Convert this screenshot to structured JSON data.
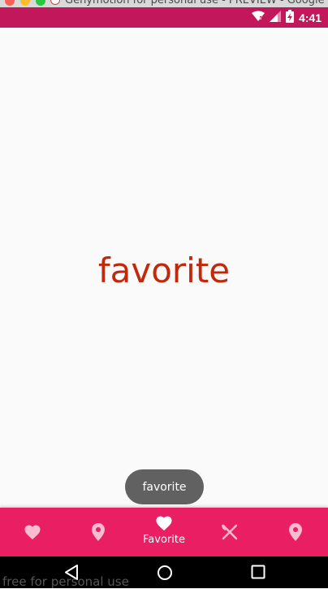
{
  "window": {
    "title": "Genymotion for personal use - PREVIEW - Google N"
  },
  "status_bar": {
    "time": "4:41",
    "color": "#c2185b"
  },
  "main": {
    "title": "favorite",
    "title_color": "#c1290c"
  },
  "toast": {
    "text": "favorite"
  },
  "bottom_nav": {
    "color": "#e91e63",
    "items": [
      {
        "icon": "heart-icon",
        "label": "",
        "active": false
      },
      {
        "icon": "location-pin-icon",
        "label": "",
        "active": false
      },
      {
        "icon": "heart-icon",
        "label": "Favorite",
        "active": true
      },
      {
        "icon": "restaurant-icon",
        "label": "",
        "active": false
      },
      {
        "icon": "location-pin-icon",
        "label": "",
        "active": false
      }
    ]
  },
  "watermark": {
    "text": "free for personal use"
  }
}
